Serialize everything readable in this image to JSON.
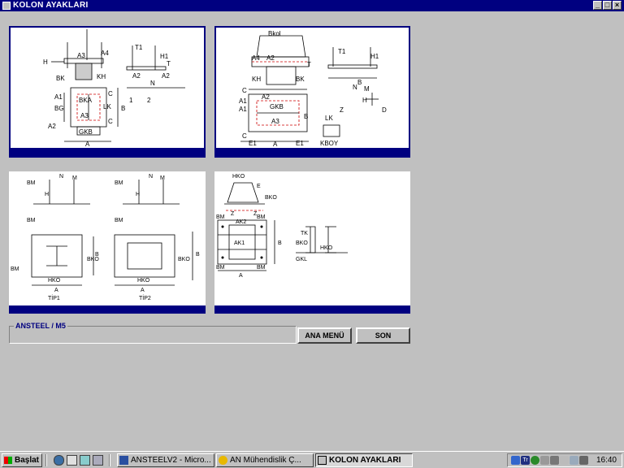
{
  "window": {
    "title": "KOLON AYAKLARI"
  },
  "window_controls": {
    "minimize": "_",
    "maximize": "□",
    "close": "×"
  },
  "diagram1": {
    "labels": [
      "A3",
      "A4",
      "T1",
      "H1",
      "H",
      "BK",
      "KH",
      "A2",
      "A2",
      "T",
      "N",
      "1",
      "2",
      "BKA",
      "BG",
      "A1",
      "A3",
      "LK",
      "B",
      "A2",
      "GKB",
      "A",
      "C",
      "C"
    ]
  },
  "diagram2": {
    "labels": [
      "Bkol",
      "A4",
      "A2",
      "T",
      "T1",
      "H1",
      "KH",
      "BK",
      "B",
      "A1",
      "A2",
      "GKB",
      "A1",
      "A3",
      "B",
      "C",
      "C",
      "E1",
      "E1",
      "A",
      "N",
      "M",
      "H",
      "Z",
      "D",
      "LK",
      "KBOY"
    ]
  },
  "diagram3": {
    "labels": [
      "BM",
      "M",
      "N",
      "H",
      "BM",
      "M",
      "N",
      "H",
      "BM",
      "BM",
      "BM",
      "HKO",
      "A",
      "BKO",
      "B",
      "TİP1",
      "HKO",
      "A",
      "BKO",
      "B",
      "TİP2"
    ]
  },
  "diagram4": {
    "labels": [
      "HKO",
      "E",
      "BKO",
      "Z",
      "Z",
      "BM",
      "BM",
      "AK2",
      "AK1",
      "BM",
      "BM",
      "B",
      "A",
      "BKO",
      "TK",
      "HKO",
      "GKL"
    ]
  },
  "group": {
    "label": "ANSTEEL  / M5"
  },
  "buttons": {
    "main_menu": "ANA MENÜ",
    "exit": "SON"
  },
  "taskbar": {
    "start_label": "Başlat",
    "tasks": [
      {
        "label": "ANSTEELV2 - Micro..."
      },
      {
        "label": "AN Mühendislik      Ç..."
      },
      {
        "label": "KOLON AYAKLARI"
      }
    ],
    "clock": "16:40",
    "tray_text": "Tr"
  }
}
